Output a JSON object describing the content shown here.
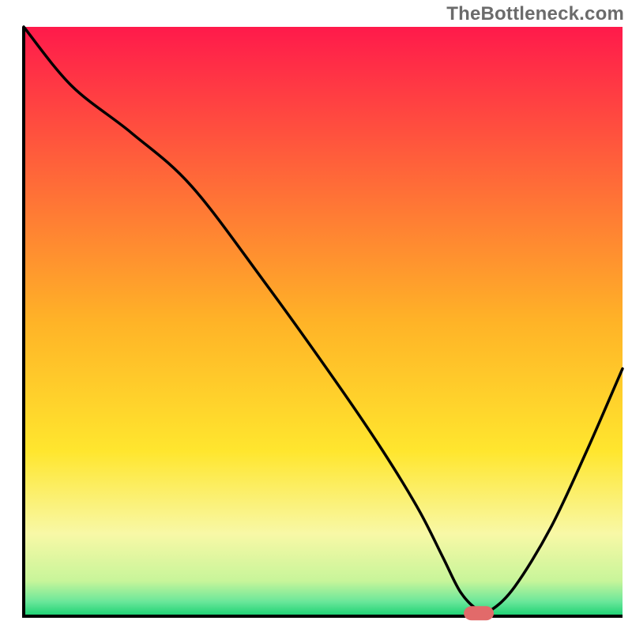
{
  "watermark": "TheBottleneck.com",
  "chart_data": {
    "type": "line",
    "title": "",
    "xlabel": "",
    "ylabel": "",
    "xlim": [
      0,
      100
    ],
    "ylim": [
      0,
      100
    ],
    "grid": false,
    "legend": false,
    "background_gradient": {
      "stops": [
        {
          "offset": 0.0,
          "color": "#ff1a4b"
        },
        {
          "offset": 0.5,
          "color": "#ffb327"
        },
        {
          "offset": 0.72,
          "color": "#ffe62e"
        },
        {
          "offset": 0.86,
          "color": "#f8f8a6"
        },
        {
          "offset": 0.94,
          "color": "#c8f59a"
        },
        {
          "offset": 0.975,
          "color": "#6be79a"
        },
        {
          "offset": 1.0,
          "color": "#19d172"
        }
      ]
    },
    "curve": {
      "name": "bottleneck-curve",
      "color": "#000000",
      "x": [
        0,
        8,
        18,
        28,
        40,
        52,
        60,
        66,
        70,
        73,
        76,
        78,
        82,
        88,
        94,
        100
      ],
      "y": [
        100,
        90,
        82,
        73,
        57,
        40,
        28,
        18,
        10,
        4,
        1,
        1,
        5,
        15,
        28,
        42
      ]
    },
    "marker": {
      "name": "selected-point",
      "x": 76,
      "y": 0.5,
      "color": "#e26a6a"
    }
  }
}
